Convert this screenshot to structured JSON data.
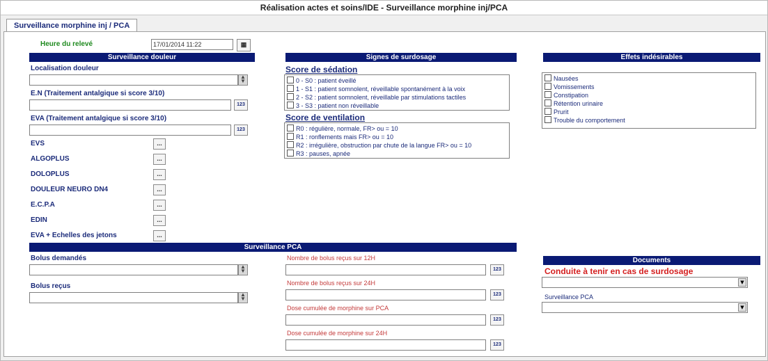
{
  "window": {
    "title": "Réalisation actes et soins/IDE - Surveillance morphine inj/PCA"
  },
  "tab": {
    "label": "Surveillance morphine inj / PCA"
  },
  "releve": {
    "label": "Heure du relevé",
    "value": "17/01/2014 11:22"
  },
  "douleur": {
    "header": "Surveillance douleur",
    "localisation_label": "Localisation douleur",
    "en_label": "E.N (Traitement antalgique si score 3/10)",
    "eva_label": "EVA (Traitement antalgique si score 3/10)",
    "btn123": "123",
    "scales": [
      "EVS",
      "ALGOPLUS",
      "DOLOPLUS",
      "DOULEUR NEURO DN4",
      "E.C.P.A",
      "EDIN",
      "EVA + Echelles des jetons"
    ],
    "scale_btn": "..."
  },
  "surdosage": {
    "header": "Signes de surdosage",
    "sedation_title": "Score de sédation",
    "sedation_items": [
      "0 - S0 : patient éveillé",
      "1 - S1 : patient somnolent, réveillable spontanément à la voix",
      "2 - S2 : patient somnolent, réveillable par stimulations tactiles",
      "3 - S3 : patient non réveillable"
    ],
    "ventilation_title": "Score de ventilation",
    "ventilation_items": [
      "R0 : régulière, normale, FR> ou = 10",
      "R1 : ronflements mais FR> ou = 10",
      "R2 : irrégulière, obstruction par chute de la langue FR> ou = 10",
      "R3 : pauses, apnée"
    ]
  },
  "effets": {
    "header": "Effets indésirables",
    "items": [
      "Nausées",
      "Vomissements",
      "Constipation",
      "Rétention urinaire",
      "Prurit",
      "Trouble du comportement"
    ]
  },
  "pca": {
    "header": "Surveillance PCA",
    "bolus_demandes": "Bolus demandés",
    "bolus_recus": "Bolus reçus",
    "fields": [
      "Nombre de bolus reçus sur 12H",
      "Nombre de bolus reçus sur 24H",
      "Dose cumulée de morphine sur PCA",
      "Dose cumulée de morphine sur 24H"
    ]
  },
  "documents": {
    "header": "Documents",
    "conduite_label": "Conduite à tenir en cas de surdosage",
    "surveillance_label": "Surveillance PCA"
  },
  "colors": {
    "header_bg": "#0a1a74",
    "label_blue": "#1b2b7a",
    "green": "#1f8a1f",
    "red": "#d42020"
  }
}
